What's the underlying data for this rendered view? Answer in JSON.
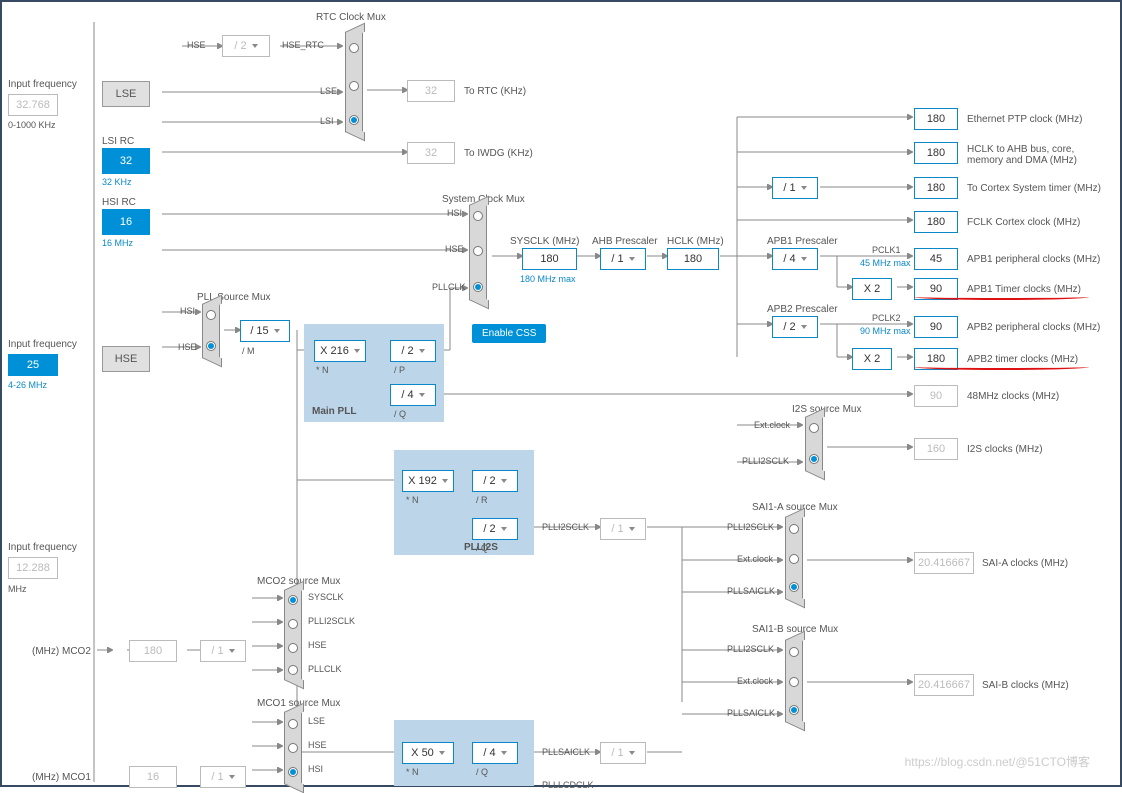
{
  "inputs": {
    "lse": {
      "label": "Input frequency",
      "val": "32.768",
      "range": "0-1000 KHz",
      "src": "LSE"
    },
    "hse": {
      "label": "Input frequency",
      "val": "25",
      "range": "4-26 MHz",
      "src": "HSE"
    },
    "i2s": {
      "label": "Input frequency",
      "val": "12.288",
      "unit": "MHz"
    }
  },
  "osc": {
    "lsi": {
      "label": "LSI RC",
      "val": "32",
      "note": "32 KHz"
    },
    "hsi": {
      "label": "HSI RC",
      "val": "16",
      "note": "16 MHz"
    }
  },
  "rtc": {
    "title": "RTC Clock Mux",
    "hse": "HSE",
    "hsertc": "HSE_RTC",
    "div": "/ 2",
    "lse": "LSE",
    "lsi": "LSI",
    "out": "32",
    "outlbl": "To RTC (KHz)"
  },
  "iwdg": {
    "val": "32",
    "lbl": "To IWDG (KHz)"
  },
  "pllsrc": {
    "title": "PLL Source Mux",
    "hsi": "HSI",
    "hse": "HSE",
    "divm": "/ 15",
    "divml": "/ M"
  },
  "mainpll": {
    "title": "Main PLL",
    "n": "X 216",
    "nl": "* N",
    "p": "/ 2",
    "pl": "/ P",
    "q": "/ 4",
    "ql": "/ Q"
  },
  "plli2s": {
    "title": "PLLI2S",
    "n": "X 192",
    "nl": "* N",
    "r": "/ 2",
    "rl": "/ R",
    "q": "/ 2",
    "ql": "/ Q",
    "out": "PLLI2SCLK"
  },
  "pllsai": {
    "n": "X 50",
    "nl": "* N",
    "q": "/ 4",
    "ql": "/ Q",
    "out": "PLLSAICLK",
    "out2": "PLLLCDCLK"
  },
  "sysmux": {
    "title": "System Clock Mux",
    "hsi": "HSI",
    "hse": "HSE",
    "pllclk": "PLLCLK",
    "css": "Enable CSS"
  },
  "sysclk": {
    "lbl": "SYSCLK (MHz)",
    "val": "180",
    "max": "180 MHz max"
  },
  "ahb": {
    "lbl": "AHB Prescaler",
    "div": "/ 1",
    "hclklbl": "HCLK (MHz)",
    "hclk": "180"
  },
  "cortex": {
    "div": "/ 1"
  },
  "apb1": {
    "lbl": "APB1 Prescaler",
    "div": "/ 4",
    "pclk": "PCLK1",
    "max": "45 MHz max",
    "timx": "X 2"
  },
  "apb2": {
    "lbl": "APB2 Prescaler",
    "div": "/ 2",
    "pclk": "PCLK2",
    "max": "90 MHz max",
    "timx": "X 2"
  },
  "outs": {
    "eth": {
      "v": "180",
      "l": "Ethernet PTP clock (MHz)"
    },
    "hclk": {
      "v": "180",
      "l": "HCLK to AHB bus, core, memory and DMA (MHz)"
    },
    "systick": {
      "v": "180",
      "l": "To Cortex System timer (MHz)"
    },
    "fclk": {
      "v": "180",
      "l": "FCLK Cortex clock (MHz)"
    },
    "apb1p": {
      "v": "45",
      "l": "APB1 peripheral clocks (MHz)"
    },
    "apb1t": {
      "v": "90",
      "l": "APB1 Timer clocks (MHz)"
    },
    "apb2p": {
      "v": "90",
      "l": "APB2 peripheral clocks (MHz)"
    },
    "apb2t": {
      "v": "180",
      "l": "APB2 timer clocks (MHz)"
    },
    "mhz48": {
      "v": "90",
      "l": "48MHz clocks (MHz)"
    },
    "i2s": {
      "v": "160",
      "l": "I2S clocks (MHz)"
    },
    "saia": {
      "v": "20.416667",
      "l": "SAI-A clocks (MHz)"
    },
    "saib": {
      "v": "20.416667",
      "l": "SAI-B clocks (MHz)"
    }
  },
  "i2smux": {
    "title": "I2S source Mux",
    "ext": "Ext.clock",
    "plli2s": "PLLI2SCLK"
  },
  "sai": {
    "div": "/ 1"
  },
  "sai1a": {
    "title": "SAI1-A source Mux",
    "plli2s": "PLLI2SCLK",
    "ext": "Ext.clock",
    "pllsai": "PLLSAICLK"
  },
  "sai1b": {
    "title": "SAI1-B source Mux",
    "plli2s": "PLLI2SCLK",
    "ext": "Ext.clock",
    "pllsai": "PLLSAICLK"
  },
  "mco2": {
    "title": "MCO2 source Mux",
    "sysclk": "SYSCLK",
    "plli2s": "PLLI2SCLK",
    "hse": "HSE",
    "pllclk": "PLLCLK",
    "div": "/ 1",
    "val": "180",
    "lbl": "(MHz) MCO2"
  },
  "mco1": {
    "title": "MCO1 source Mux",
    "lse": "LSE",
    "hse": "HSE",
    "hsi": "HSI",
    "div": "/ 1",
    "val": "16",
    "lbl": "(MHz) MCO1"
  },
  "watermark": "https://blog.csdn.net/@51CTO博客"
}
